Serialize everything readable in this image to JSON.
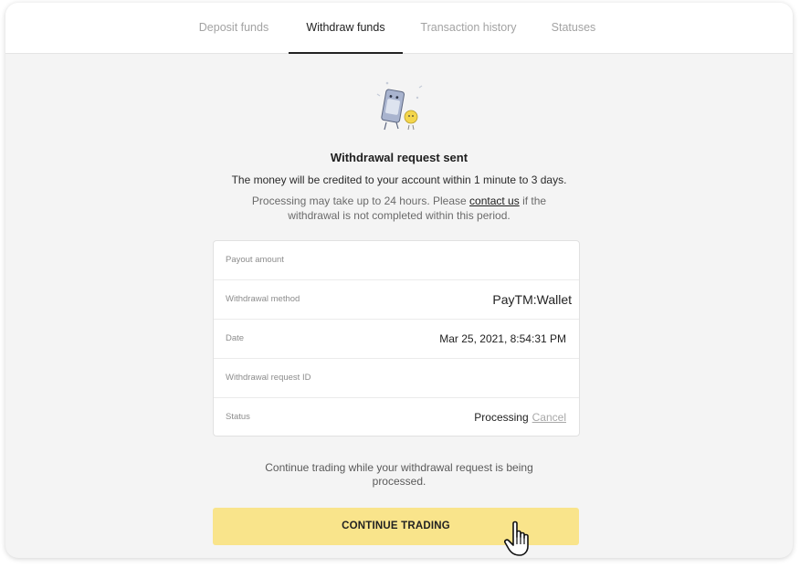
{
  "tabs": [
    {
      "label": "Deposit funds",
      "active": false
    },
    {
      "label": "Withdraw funds",
      "active": true
    },
    {
      "label": "Transaction history",
      "active": false
    },
    {
      "label": "Statuses",
      "active": false
    }
  ],
  "illustration": {
    "icon": "wallet-mascot-icon"
  },
  "message": {
    "heading": "Withdrawal request sent",
    "subtext": "The money will be credited to your account within 1 minute to 3 days.",
    "note_before_link": "Processing may take up to 24 hours. Please ",
    "note_link": "contact us",
    "note_after_link": " if the withdrawal is not completed within this period."
  },
  "details": {
    "payout_amount": {
      "label": "Payout amount",
      "value": ""
    },
    "method": {
      "label": "Withdrawal method",
      "value": "PayTM:Wallet"
    },
    "date": {
      "label": "Date",
      "value": "Mar 25, 2021, 8:54:31 PM"
    },
    "request_id": {
      "label": "Withdrawal request ID",
      "value": ""
    },
    "status": {
      "label": "Status",
      "value": "Processing",
      "cancel_label": "Cancel"
    }
  },
  "footer": {
    "continue_note": "Continue trading while your withdrawal request is being processed.",
    "button_label": "CONTINUE TRADING"
  },
  "colors": {
    "button": "#f9e48b",
    "page_background": "#f4f4f4",
    "active_tab": "#222222",
    "inactive_tab": "#a3a3a3"
  },
  "cursor": {
    "icon": "hand-pointer-icon"
  }
}
